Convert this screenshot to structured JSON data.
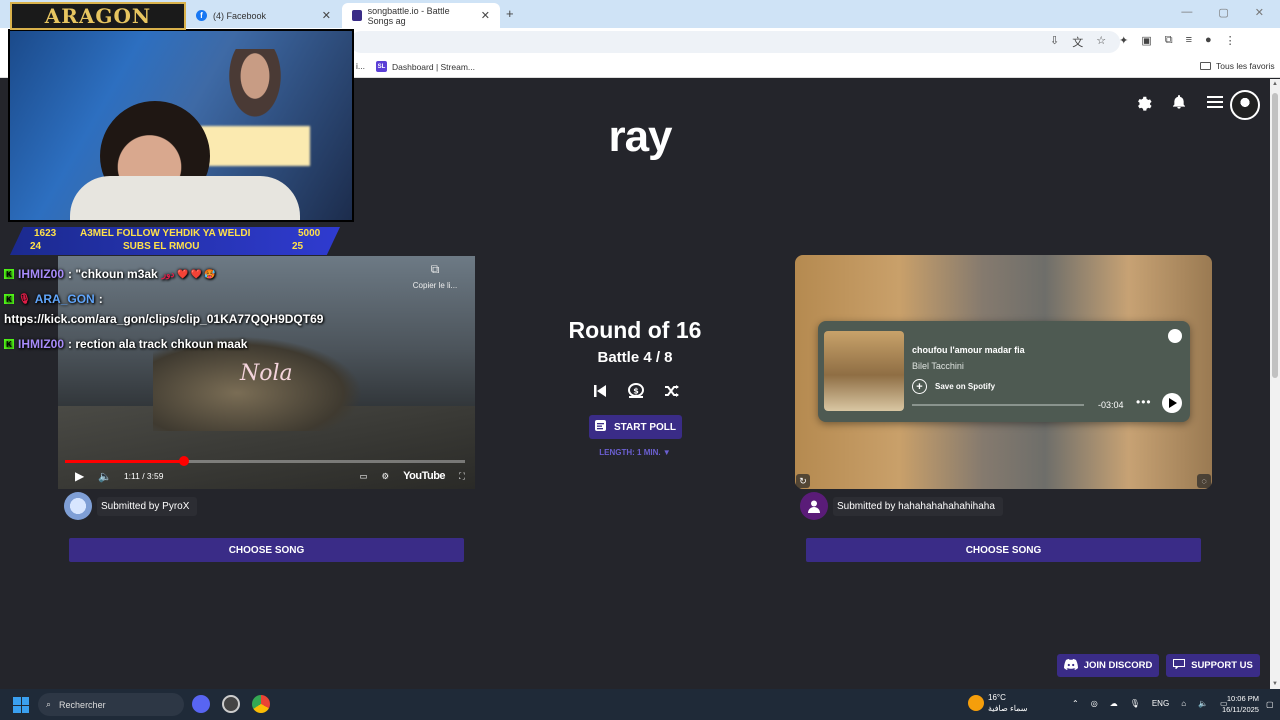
{
  "browser": {
    "tabs": [
      {
        "label": "(4) Facebook"
      },
      {
        "label": "songbattle.io - Battle Songs ag"
      }
    ],
    "bookmarks": [
      {
        "label": "Dashboard | Stream..."
      },
      {
        "label": "Tous les favoris"
      }
    ],
    "bookmark_partial": "i..."
  },
  "page": {
    "title": "ray",
    "round": "Round of 16",
    "battle": "Battle 4 / 8",
    "start_poll": "START POLL",
    "length": "LENGTH: 1 MIN. ▼",
    "left": {
      "copy_link": "Copier le li...",
      "video_time": "1:11 / 3:59",
      "progress_fraction": 0.297,
      "youtube": "YouTube",
      "watermark": "Nola",
      "submitted_by": "Submitted by PyroX",
      "choose": "CHOOSE SONG"
    },
    "right": {
      "song": "choufou l'amour madar fia",
      "artist": "Bilel Tacchini",
      "save": "Save on Spotify",
      "time": "-03:04",
      "submitted_by": "Submitted by hahahahahahahihaha",
      "choose": "CHOOSE SONG"
    },
    "join_discord": "JOIN DISCORD",
    "support_us": "SUPPORT US"
  },
  "overlay": {
    "brand": "ARAGON",
    "ticker": {
      "left_top": "1623",
      "center_top": "A3MEL FOLLOW YEHDIK YA WELDI",
      "right_top": "5000",
      "left_bottom": "24",
      "center_bottom": "SUBS EL RMOU",
      "right_bottom": "25"
    },
    "chat": [
      {
        "user": "IHMIZ00",
        "msg": ": \"chkoun m3ak",
        "extra": "دور ❤️ ❤️ 🥵"
      },
      {
        "user": "ARA_GON",
        "msg": " :",
        "extra": ""
      },
      {
        "user": "",
        "msg": "https://kick.com/ara_gon/clips/clip_01KA77QQH9DQT69",
        "extra": ""
      },
      {
        "user": "IHMIZ00",
        "msg": ": rection ala track chkoun maak",
        "extra": ""
      }
    ]
  },
  "taskbar": {
    "search": "Rechercher",
    "temp": "16°C",
    "weather_desc": "سماء صافية",
    "lang": "ENG",
    "time": "10:06 PM",
    "date": "16/11/2025"
  },
  "colors": {
    "accent": "#3a2c87",
    "page_bg": "#24252b",
    "kick_green": "#53fc18"
  }
}
